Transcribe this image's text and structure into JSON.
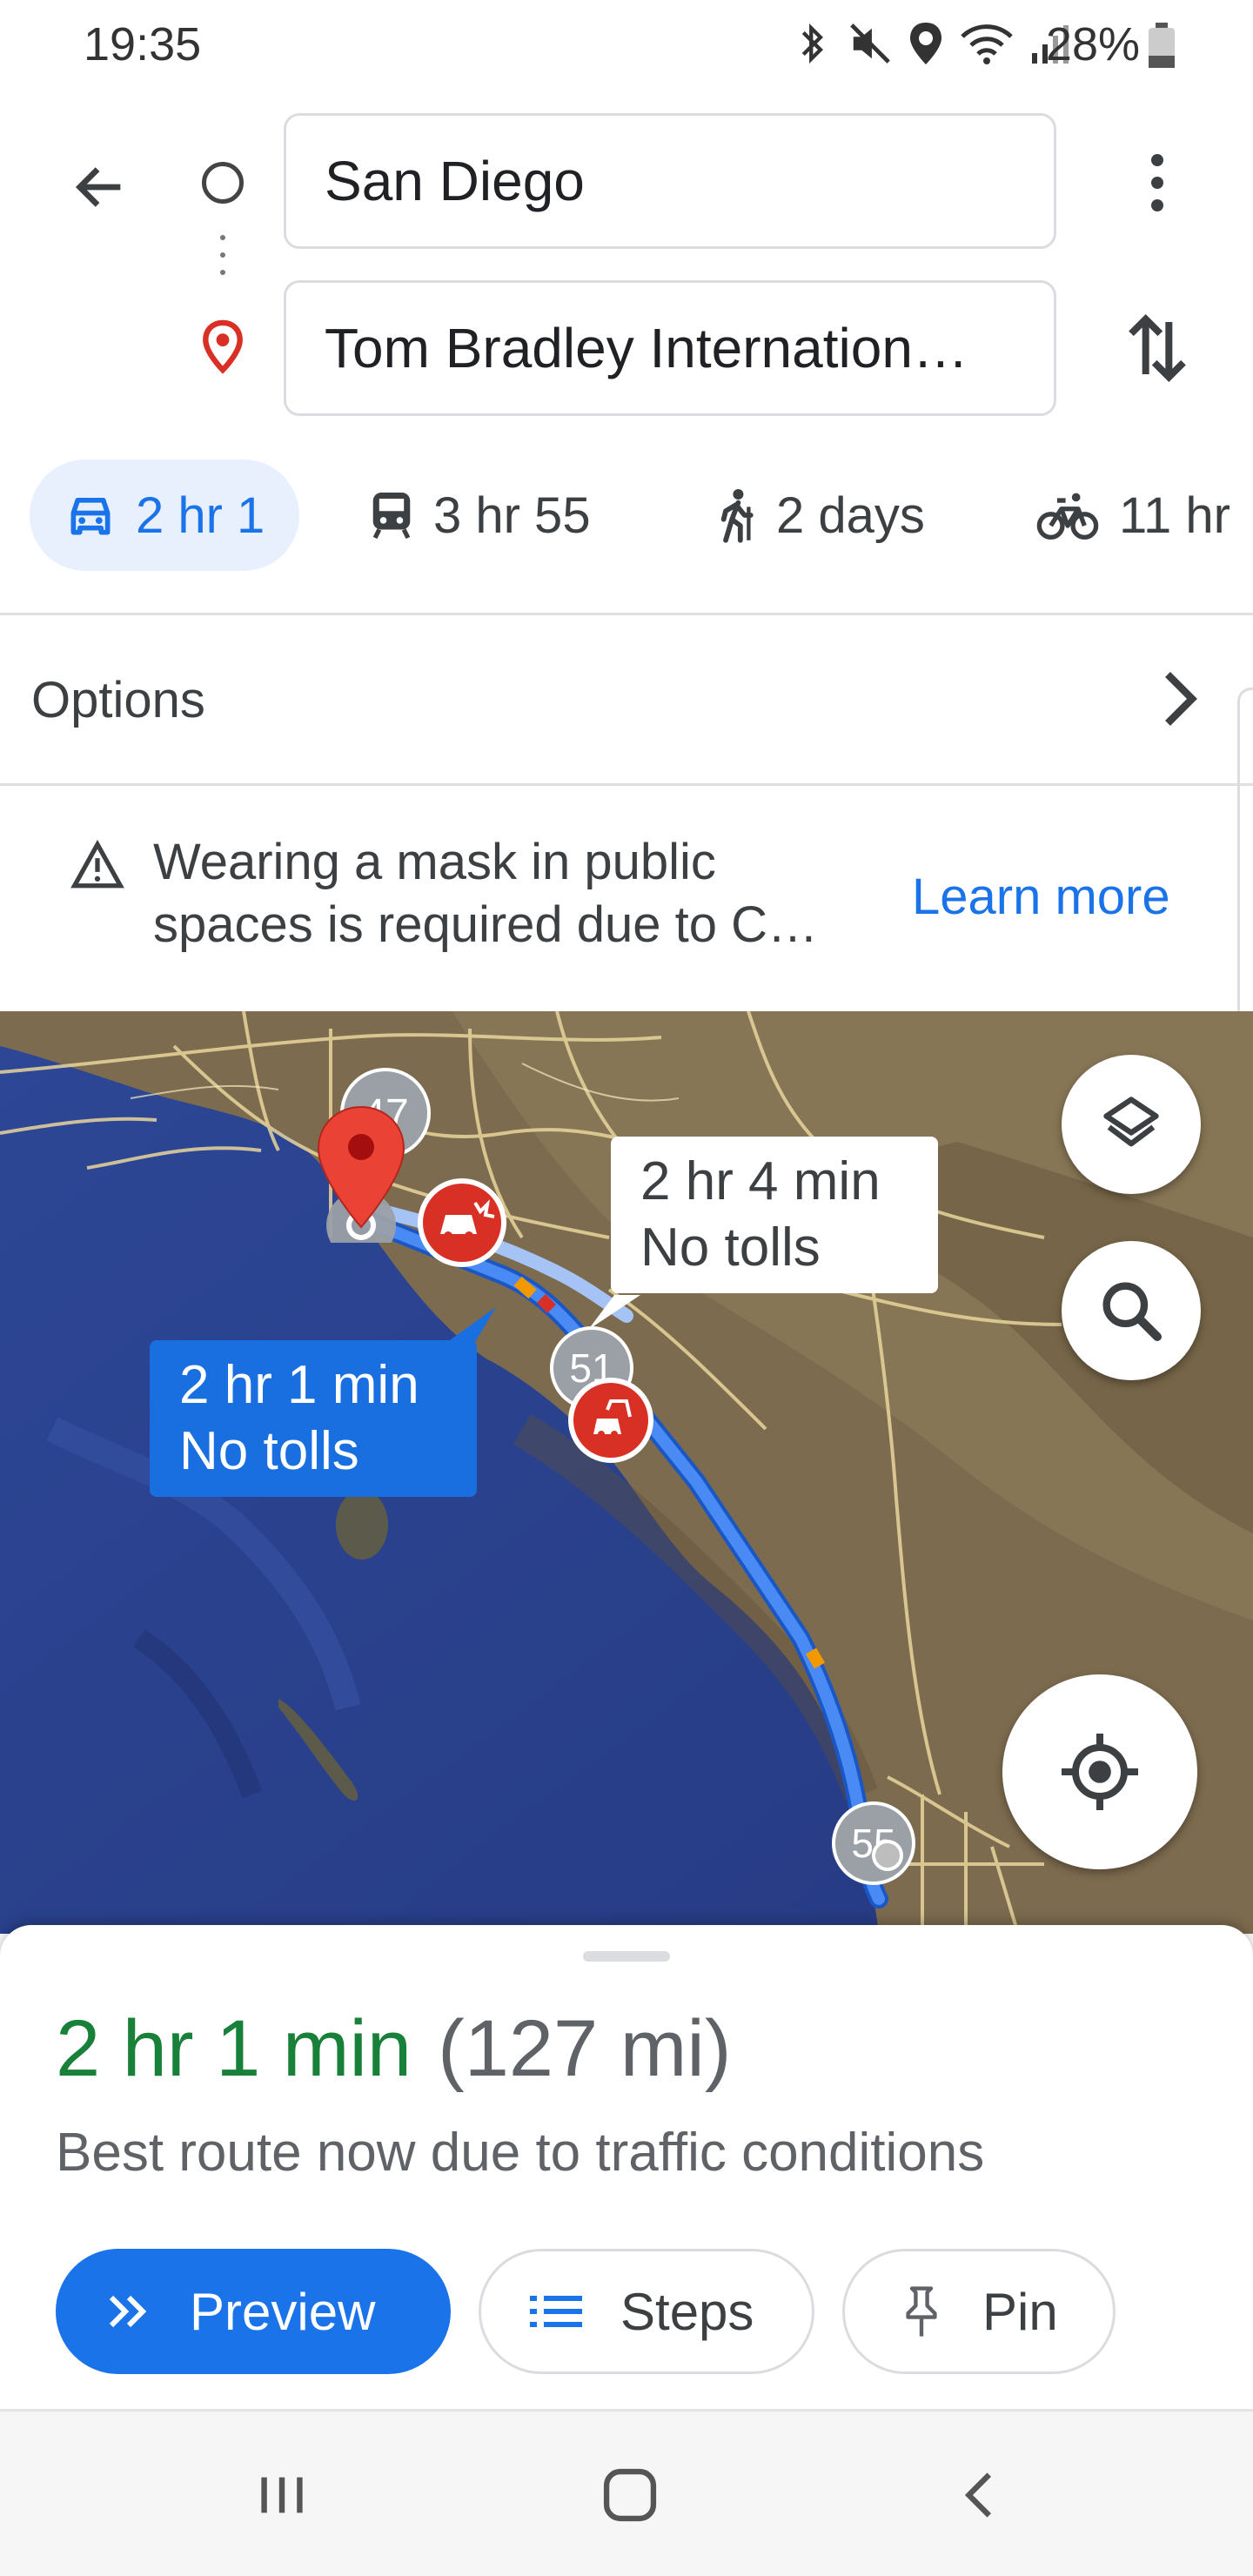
{
  "status_bar": {
    "time": "19:35",
    "battery": "28%",
    "icons": [
      "bluetooth-icon",
      "mute-icon",
      "location-icon",
      "wifi-icon",
      "signal-icon",
      "battery-icon"
    ]
  },
  "header": {
    "origin_value": "San Diego",
    "destination_value": "Tom Bradley Internation…",
    "icons": [
      "back-arrow-icon",
      "origin-circle-icon",
      "destination-pin-icon",
      "more-vert-icon",
      "swap-icon"
    ]
  },
  "modes": [
    {
      "icon": "car-icon",
      "label": "2 hr 1",
      "active": true
    },
    {
      "icon": "transit-icon",
      "label": "3 hr 55",
      "active": false
    },
    {
      "icon": "walk-icon",
      "label": "2 days",
      "active": false
    },
    {
      "icon": "bike-icon",
      "label": "11 hr",
      "active": false
    }
  ],
  "options": {
    "label": "Options"
  },
  "notice": {
    "line1": "Wearing a mask in public",
    "line2": "spaces is required due to C…",
    "link": "Learn more"
  },
  "map": {
    "primary_route": {
      "line1": "2 hr 1 min",
      "line2": "No tolls"
    },
    "alt_route": {
      "line1": "2 hr 4 min",
      "line2": "No tolls"
    },
    "highway_shields": [
      "47",
      "51",
      "55"
    ]
  },
  "sheet": {
    "duration": "2 hr 1 min",
    "distance": "(127 mi)",
    "reason": "Best route now due to traffic conditions",
    "preview_label": "Preview",
    "steps_label": "Steps",
    "pin_label": "Pin"
  },
  "colors": {
    "accent": "#1a73e8",
    "duration_green": "#188038",
    "ocean": "#2c3f8c",
    "land": "#7a6a4e",
    "route": "#4a8af4",
    "incident_red": "#d93025"
  }
}
